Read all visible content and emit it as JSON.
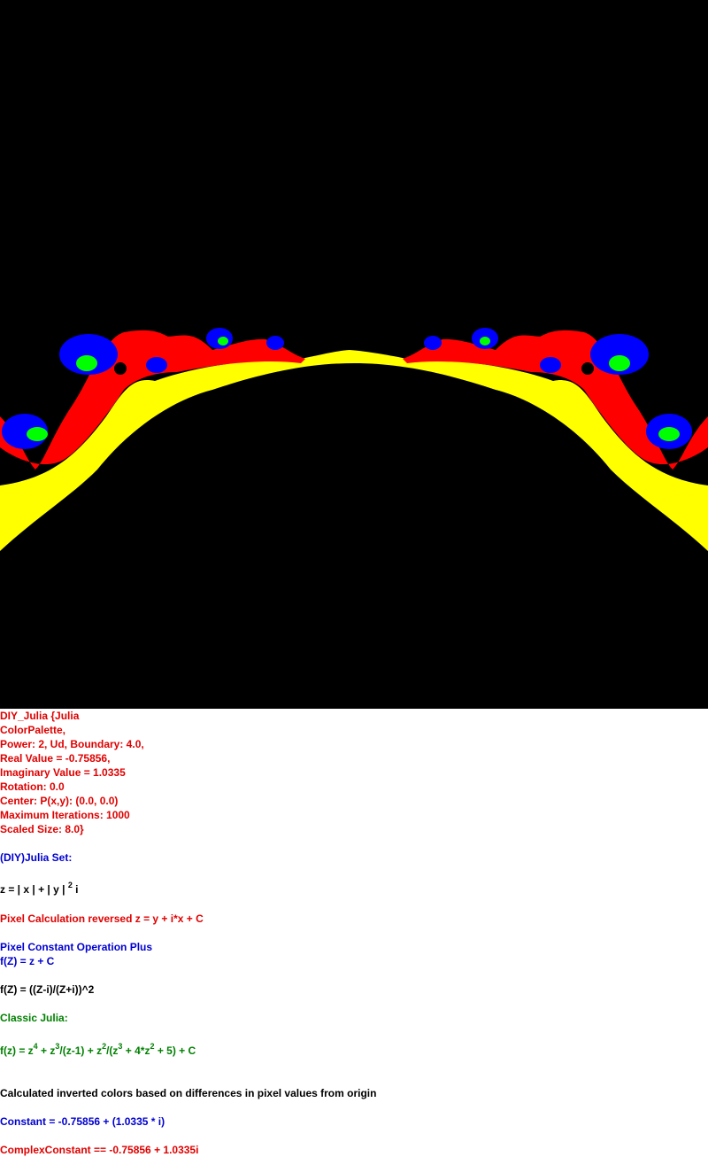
{
  "colors": {
    "background": "#000000",
    "fill_yellow": "#ffff00",
    "fill_red": "#ff0000",
    "fill_blue": "#0000ff",
    "fill_green": "#00ff00",
    "text_red": "#e00000",
    "text_blue": "#0000d0",
    "text_green": "#008000",
    "text_black": "#000000"
  },
  "params": {
    "line1": "DIY_Julia {Julia",
    "line2": "ColorPalette,",
    "line3": "Power: 2, Ud, Boundary: 4.0,",
    "line4": "Real Value = -0.75856,",
    "line5": "Imaginary Value = 1.0335",
    "line6": "Rotation: 0.0",
    "line7": "Center: P(x,y): (0.0, 0.0)",
    "line8": "Maximum Iterations: 1000",
    "line9": "Scaled Size: 8.0}"
  },
  "formula": {
    "diy_title": "(DIY)Julia Set:",
    "z_eq_part1": "z = | x | + | y | ",
    "z_eq_exp": "2",
    "z_eq_part2": " i",
    "pixel_calc": "Pixel Calculation reversed z = y + i*x + C",
    "pixel_const": "Pixel Constant Operation Plus",
    "fz_plus": "f(Z) = z + C",
    "fz_mobius": "f(Z) = ((Z-i)/(Z+i))^2",
    "classic_title": "Classic Julia:",
    "classic_a": "f(z) = z",
    "classic_e1": "4",
    "classic_b": " + z",
    "classic_e2": "3",
    "classic_c": "/(z-1) + z",
    "classic_e3": "2",
    "classic_d": "/(z",
    "classic_e4": "3",
    "classic_e": " + 4*z",
    "classic_e5": "2",
    "classic_f": " + 5) + C",
    "inverted_note": "Calculated inverted colors based on differences in pixel values from origin",
    "constant": "Constant = -0.75856 + (1.0335 * i)",
    "complex_constant": "ComplexConstant == -0.75856 + 1.0335i"
  }
}
